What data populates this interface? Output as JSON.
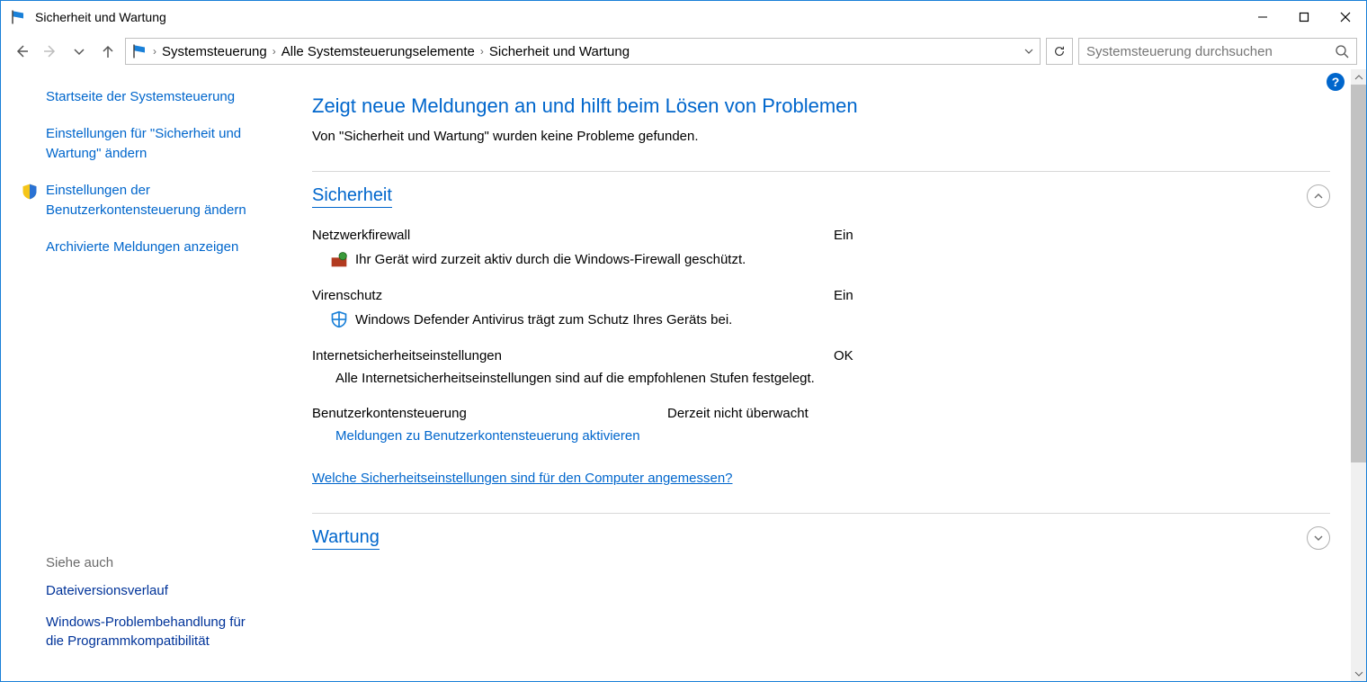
{
  "window": {
    "title": "Sicherheit und Wartung"
  },
  "breadcrumbs": {
    "a": "Systemsteuerung",
    "b": "Alle Systemsteuerungselemente",
    "c": "Sicherheit und Wartung"
  },
  "search": {
    "placeholder": "Systemsteuerung durchsuchen"
  },
  "sidebar": {
    "home": "Startseite der Systemsteuerung",
    "link1": "Einstellungen für \"Sicherheit und Wartung\" ändern",
    "link2": "Einstellungen der Benutzerkontensteuerung ändern",
    "link3": "Archivierte Meldungen anzeigen",
    "see_also": "Siehe auch",
    "sa1": "Dateiversionsverlauf",
    "sa2": "Windows-Problembehandlung für die Programmkompatibilität"
  },
  "main": {
    "heading": "Zeigt neue Meldungen an und hilft beim Lösen von Problemen",
    "sub": "Von \"Sicherheit und Wartung\" wurden keine Probleme gefunden."
  },
  "sec": {
    "title": "Sicherheit",
    "firewall": {
      "label": "Netzwerkfirewall",
      "status": "Ein",
      "detail": "Ihr Gerät wird zurzeit aktiv durch die Windows-Firewall geschützt."
    },
    "av": {
      "label": "Virenschutz",
      "status": "Ein",
      "detail": "Windows Defender Antivirus trägt zum Schutz Ihres Geräts bei."
    },
    "inet": {
      "label": "Internetsicherheitseinstellungen",
      "status": "OK",
      "detail": "Alle Internetsicherheitseinstellungen sind auf die empfohlenen Stufen festgelegt."
    },
    "uac": {
      "label": "Benutzerkontensteuerung",
      "status": "Derzeit nicht überwacht",
      "link": "Meldungen zu Benutzerkontensteuerung aktivieren"
    },
    "footer": "Welche Sicherheitseinstellungen sind für den Computer angemessen?"
  },
  "maint": {
    "title": "Wartung"
  }
}
